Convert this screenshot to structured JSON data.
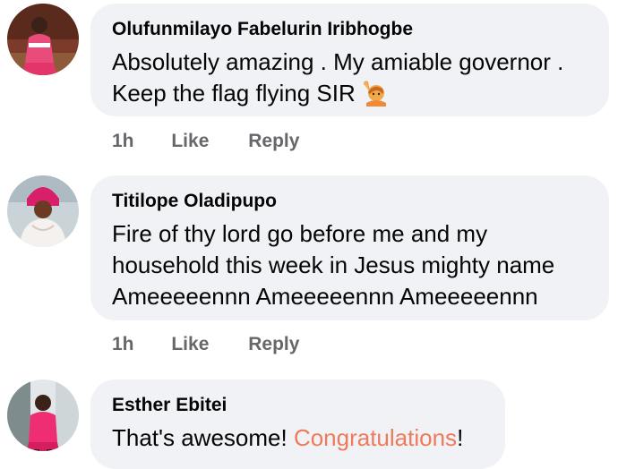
{
  "comments": [
    {
      "author": "Olufunmilayo Fabelurin Iribhogbe",
      "lines": [
        "Absolutely amazing . My amiable governor .",
        "Keep the flag flying SIR"
      ],
      "emoji": "raising-hand-icon",
      "time": "1h",
      "like_label": "Like",
      "reply_label": "Reply"
    },
    {
      "author": "Titilope Oladipupo",
      "lines": [
        "Fire of thy lord go before me and my",
        "household this week in Jesus mighty name",
        "Ameeeeennn Ameeeeennn Ameeeeennn"
      ],
      "time": "1h",
      "like_label": "Like",
      "reply_label": "Reply"
    },
    {
      "author": "Esther Ebitei",
      "text_before": "That's awesome! ",
      "highlight": "Congratulations",
      "text_after": "!",
      "highlight_color": "#ef7a5b"
    }
  ],
  "colors": {
    "bubble": "#f0f2f5",
    "meta_text": "#65676b",
    "text": "#050505"
  }
}
